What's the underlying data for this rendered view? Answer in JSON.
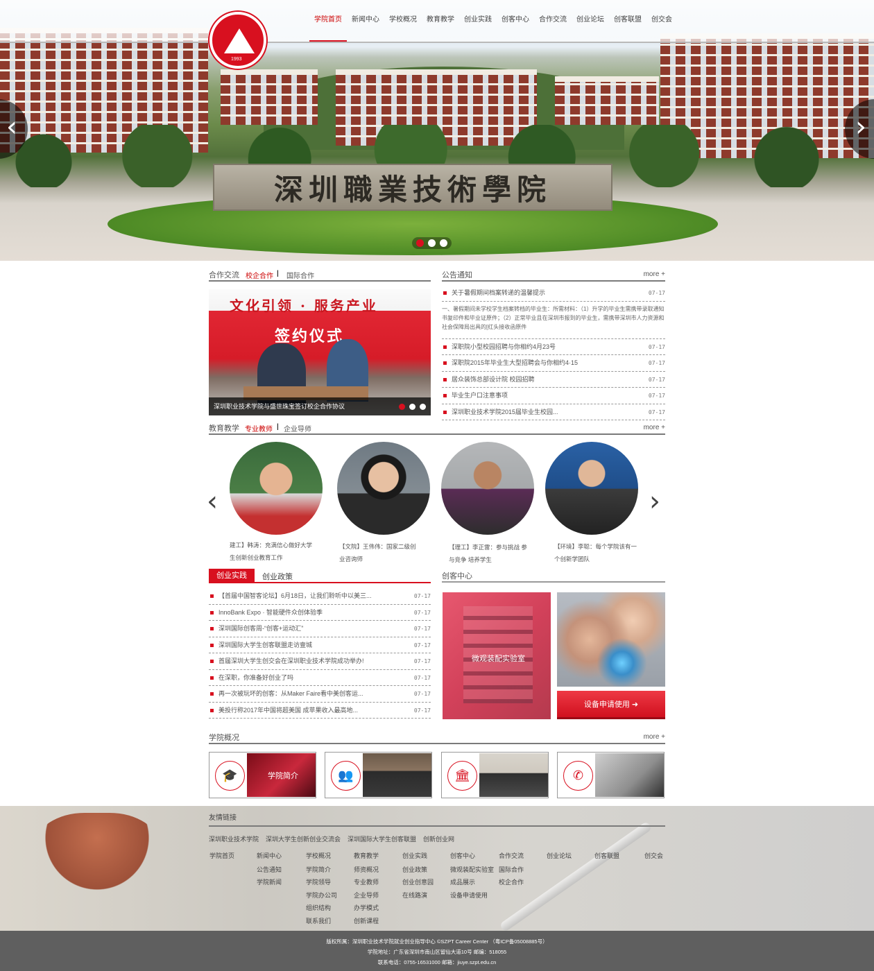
{
  "nav": {
    "items": [
      "学院首页",
      "新闻中心",
      "学校概况",
      "教育教学",
      "创业实践",
      "创客中心",
      "合作交流",
      "创业论坛",
      "创客联盟",
      "创交会"
    ],
    "active_index": 0
  },
  "logo": {
    "year": "1993"
  },
  "banner": {
    "stone_text": "深圳職業技術學院",
    "prev_icon": "chevron-left-icon",
    "next_icon": "chevron-right-icon",
    "slide_count": 3,
    "active_slide": 1
  },
  "coop": {
    "title": "合作交流",
    "tab_active": "校企合作",
    "tab_other": "国际合作",
    "image_heading": "文化引领 · 服务产业",
    "image_subheading": "签约仪式",
    "caption": "深圳职业技术学院与盛世珠宝签订校企合作协议"
  },
  "notice": {
    "title": "公告通知",
    "more": "more +",
    "items": [
      {
        "text": "关于暑假期间档案转递的温馨提示",
        "date": "07-17"
      },
      {
        "desc": "一、暑假期间未学校学生档案转档的毕业生：所需材料：（1）升学的毕业生需携带录取通知书复印件和毕业证原件；（2）正常毕业且在深圳市报到的毕业生，需携带深圳市人力资源和社会保障局出具的[红头接收函原件"
      },
      {
        "text": "深职院小型校园招聘与你相约4月23号",
        "date": "07-17"
      },
      {
        "text": "深职院2015年毕业生大型招聘会与你相约4·15",
        "date": "07-17"
      },
      {
        "text": "居众装饰总部设计院 校园招聘",
        "date": "07-17"
      },
      {
        "text": "毕业生户口注意事项",
        "date": "07-17"
      },
      {
        "text": "深圳职业技术学院2015届毕业生校园...",
        "date": "07-17"
      }
    ]
  },
  "teaching": {
    "title": "教育教学",
    "tab_active": "专业教师",
    "tab_other": "企业导师",
    "more": "more +",
    "teachers": [
      {
        "line1": "建工】韩涛：充满信心做好大学",
        "line2": "生创新创业教育工作"
      },
      {
        "line1": "【文院】王伟伟：国家二级创",
        "line2": "业咨询师"
      },
      {
        "line1": "【理工】李正雷：参与挑战 参",
        "line2": "与竞争 培养学生"
      },
      {
        "line1": "【环境】李聪：每个学院该有一",
        "line2": "个创新学团队"
      }
    ]
  },
  "practice": {
    "tab_active": "创业实践",
    "tab_other": "创业政策",
    "items": [
      {
        "text": "【首届中国智客论坛】6月18日，让我们聆听中以美三...",
        "date": "07-17"
      },
      {
        "text": "InnoBank Expo · 智能硬件众创体验季",
        "date": "07-17"
      },
      {
        "text": "深圳国际创客周-“创客+运动汇”",
        "date": "07-17"
      },
      {
        "text": "深圳国际大学生创客联盟走访壹城",
        "date": "07-17"
      },
      {
        "text": "首届深圳大学生创交会在深圳职业技术学院成功举办!",
        "date": "07-17"
      },
      {
        "text": "在深职，你准备好创业了吗",
        "date": "07-17"
      },
      {
        "text": "再一次被玩坏的创客：从Maker Faire看中美创客运...",
        "date": "07-17"
      },
      {
        "text": "美投行称2017年中国将超美国 成苹果收入最高地...",
        "date": "07-17"
      }
    ]
  },
  "maker": {
    "title": "创客中心",
    "lab_caption": "微观装配实验室",
    "apply_label": "设备申请使用"
  },
  "overview": {
    "title": "学院概况",
    "more": "more +",
    "cards": [
      {
        "icon": "graduation-cap-icon",
        "overlay": "学院简介"
      },
      {
        "icon": "group-icon",
        "overlay": ""
      },
      {
        "icon": "building-icon",
        "overlay": ""
      },
      {
        "icon": "phone-icon",
        "overlay": ""
      }
    ]
  },
  "footer": {
    "links_title": "友情链接",
    "links": [
      "深圳职业技术学院",
      "深圳大学生创新创业交流会",
      "深圳国际大学生创客联盟",
      "创新创业网"
    ],
    "columns": [
      {
        "head": "学院首页",
        "items": []
      },
      {
        "head": "新闻中心",
        "items": [
          "公告通知",
          "学院新闻"
        ]
      },
      {
        "head": "学校概况",
        "items": [
          "学院简介",
          "学院领导",
          "学院办公司",
          "组织结构",
          "联系我们"
        ]
      },
      {
        "head": "教育教学",
        "items": [
          "师资概况",
          "专业教师",
          "企业导师",
          "办学模式",
          "创新课程"
        ]
      },
      {
        "head": "创业实践",
        "items": [
          "创业政策",
          "创业创意园",
          "在线路演"
        ]
      },
      {
        "head": "创客中心",
        "items": [
          "微观装配实验室",
          "成品展示",
          "设备申请使用"
        ]
      },
      {
        "head": "合作交流",
        "items": [
          "国际合作",
          "校企合作"
        ]
      },
      {
        "head": "创业论坛",
        "items": []
      },
      {
        "head": "创客联盟",
        "items": []
      },
      {
        "head": "创交会",
        "items": []
      }
    ],
    "copyright": "版权所属：深圳职业技术学院就业创业指导中心 ©SZPT Career Center （粤ICP备05008885号）",
    "address": "学院地址：广东省深圳市南山区留仙大道10号 邮编：518055",
    "contact": "联系电话：0755-16531000 邮箱：jiuye.szpt.edu.cn"
  },
  "colors": {
    "accent": "#d8101f",
    "footer_bar": "#5f5f5f"
  }
}
